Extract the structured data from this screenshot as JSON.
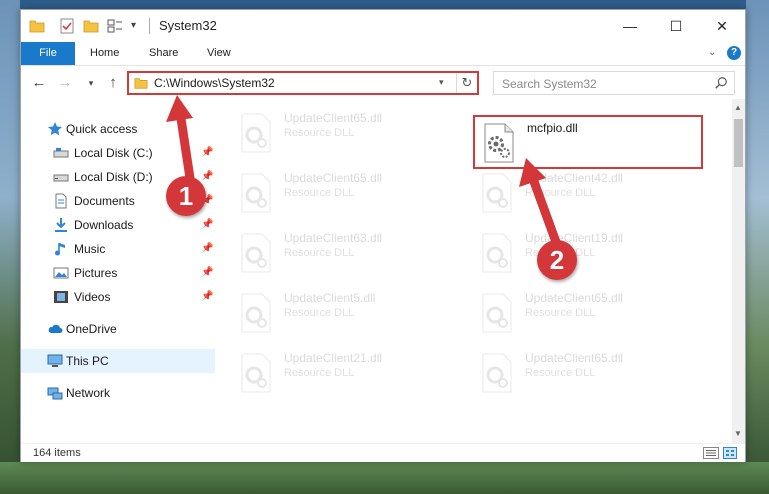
{
  "window": {
    "title": "System32",
    "min_symbol": "—",
    "max_symbol": "☐",
    "close_symbol": "✕"
  },
  "ribbon": {
    "tabs": [
      {
        "label": "File"
      },
      {
        "label": "Home"
      },
      {
        "label": "Share"
      },
      {
        "label": "View"
      }
    ],
    "help_symbol": "?"
  },
  "address": {
    "path": "C:\\Windows\\System32",
    "refresh_symbol": "↻"
  },
  "search": {
    "placeholder": "Search System32"
  },
  "nav": {
    "back_symbol": "←",
    "forward_symbol": "→",
    "recent_symbol": "▾",
    "up_symbol": "↑",
    "items": [
      {
        "label": "Quick access",
        "icon": "star-icon",
        "pinned": false
      },
      {
        "label": "Local Disk (C:)",
        "icon": "drive-icon",
        "pinned": true
      },
      {
        "label": "Local Disk (D:)",
        "icon": "drive-icon",
        "pinned": true
      },
      {
        "label": "Documents",
        "icon": "documents-icon",
        "pinned": true
      },
      {
        "label": "Downloads",
        "icon": "downloads-icon",
        "pinned": true
      },
      {
        "label": "Music",
        "icon": "music-icon",
        "pinned": true
      },
      {
        "label": "Pictures",
        "icon": "pictures-icon",
        "pinned": true
      },
      {
        "label": "Videos",
        "icon": "videos-icon",
        "pinned": true
      },
      {
        "label": "OneDrive",
        "icon": "onedrive-icon",
        "pinned": false
      },
      {
        "label": "This PC",
        "icon": "computer-icon",
        "pinned": false,
        "selected": true
      },
      {
        "label": "Network",
        "icon": "network-icon",
        "pinned": false
      }
    ]
  },
  "files": [
    {
      "name": "UpdateClient65.dll",
      "type": "Resource DLL",
      "faded": true
    },
    {
      "name": "mcfpio.dll",
      "type": "",
      "faded": false,
      "highlighted": true
    },
    {
      "name": "UpdateClient65.dll",
      "type": "Resource DLL",
      "faded": true
    },
    {
      "name": "UpdateClient42.dll",
      "type": "Resource DLL",
      "faded": true
    },
    {
      "name": "UpdateClient63.dll",
      "type": "Resource DLL",
      "faded": true
    },
    {
      "name": "UpdateClient19.dll",
      "type": "Resource DLL",
      "faded": true
    },
    {
      "name": "UpdateClient5.dll",
      "type": "Resource DLL",
      "faded": true
    },
    {
      "name": "UpdateClient65.dll",
      "type": "Resource DLL",
      "faded": true
    },
    {
      "name": "UpdateClient21.dll",
      "type": "Resource DLL",
      "faded": true
    },
    {
      "name": "UpdateClient65.dll",
      "type": "Resource DLL",
      "faded": true
    }
  ],
  "status": {
    "item_count": "164 items"
  },
  "callouts": {
    "step1": "1",
    "step2": "2"
  },
  "colors": {
    "accent": "#1979ca",
    "highlight_border": "#d23a3a",
    "callout": "#d4373a",
    "selected_bg": "#cce8ff"
  }
}
